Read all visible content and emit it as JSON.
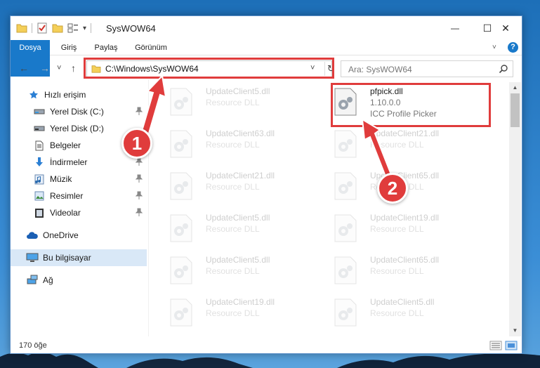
{
  "window": {
    "title": "SysWOW64",
    "qat_dropdown": "▾",
    "minimize": "—",
    "maximize": "☐",
    "close": "✕"
  },
  "ribbon": {
    "tabs": [
      "Dosya",
      "Giriş",
      "Paylaş",
      "Görünüm"
    ],
    "help": "?"
  },
  "navigation": {
    "back": "←",
    "forward": "→",
    "recent": "˅",
    "up": "↑",
    "address": "C:\\Windows\\SysWOW64",
    "address_dropdown": "˅",
    "refresh": "↻",
    "search_placeholder": "Ara: SysWOW64"
  },
  "sidebar": {
    "items": [
      {
        "label": "Hızlı erişim",
        "icon": "star-icon",
        "pinned": false
      },
      {
        "label": "Yerel Disk (C:)",
        "icon": "drive-icon",
        "pinned": true
      },
      {
        "label": "Yerel Disk (D:)",
        "icon": "drive-icon",
        "pinned": false
      },
      {
        "label": "Belgeler",
        "icon": "document-icon",
        "pinned": true
      },
      {
        "label": "İndirmeler",
        "icon": "download-icon",
        "pinned": true
      },
      {
        "label": "Müzik",
        "icon": "music-icon",
        "pinned": true
      },
      {
        "label": "Resimler",
        "icon": "pictures-icon",
        "pinned": true
      },
      {
        "label": "Videolar",
        "icon": "video-icon",
        "pinned": true
      },
      {
        "label": "OneDrive",
        "icon": "cloud-icon",
        "pinned": false
      },
      {
        "label": "Bu bilgisayar",
        "icon": "computer-icon",
        "pinned": false,
        "selected": true
      },
      {
        "label": "Ağ",
        "icon": "network-icon",
        "pinned": false
      }
    ]
  },
  "files": {
    "left": [
      {
        "name": "UpdateClient5.dll",
        "type": "Resource DLL"
      },
      {
        "name": "UpdateClient63.dll",
        "type": "Resource DLL"
      },
      {
        "name": "UpdateClient21.dll",
        "type": "Resource DLL"
      },
      {
        "name": "UpdateClient5.dll",
        "type": "Resource DLL"
      },
      {
        "name": "UpdateClient5.dll",
        "type": "Resource DLL"
      },
      {
        "name": "UpdateClient19.dll",
        "type": "Resource DLL"
      }
    ],
    "right": [
      {
        "name": "pfpick.dll",
        "version": "1.10.0.0",
        "type": "ICC Profile Picker",
        "highlighted": true
      },
      {
        "name": "UpdateClient21.dll",
        "type": "Resource DLL"
      },
      {
        "name": "UpdateClient65.dll",
        "type": "Resource DLL"
      },
      {
        "name": "UpdateClient19.dll",
        "type": "Resource DLL"
      },
      {
        "name": "UpdateClient65.dll",
        "type": "Resource DLL"
      },
      {
        "name": "UpdateClient5.dll",
        "type": "Resource DLL"
      }
    ]
  },
  "status": {
    "count": "170 öğe"
  },
  "annotations": {
    "step1": "1",
    "step2": "2",
    "color": "#e03c3c"
  },
  "colors": {
    "accent": "#1979ca",
    "selection": "#d9e8f7"
  }
}
